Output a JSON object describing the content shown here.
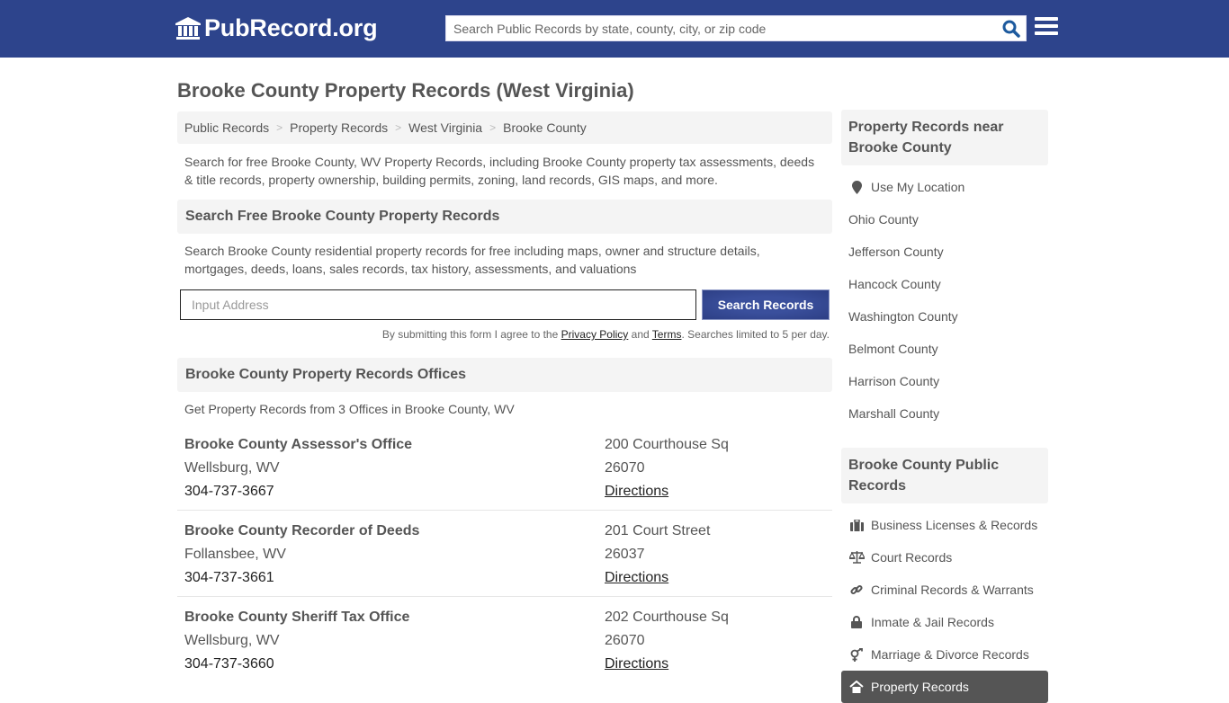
{
  "header": {
    "logo_text": "PubRecord.org",
    "search_placeholder": "Search Public Records by state, county, city, or zip code",
    "brand_color": "#2d448c"
  },
  "page_title": "Brooke County Property Records (West Virginia)",
  "breadcrumb": [
    "Public Records",
    "Property Records",
    "West Virginia",
    "Brooke County"
  ],
  "intro": "Search for free Brooke County, WV Property Records, including Brooke County property tax assessments, deeds & title records, property ownership, building permits, zoning, land records, GIS maps, and more.",
  "search_section": {
    "heading": "Search Free Brooke County Property Records",
    "description": "Search Brooke County residential property records for free including maps, owner and structure details, mortgages, deeds, loans, sales records, tax history, assessments, and valuations",
    "input_placeholder": "Input Address",
    "button_label": "Search Records",
    "disclaimer_prefix": "By submitting this form I agree to the ",
    "privacy_label": "Privacy Policy",
    "and_text": " and ",
    "terms_label": "Terms",
    "disclaimer_suffix": ". Searches limited to 5 per day."
  },
  "offices_section": {
    "heading": "Brooke County Property Records Offices",
    "subtitle": "Get Property Records from 3 Offices in Brooke County, WV",
    "offices": [
      {
        "name": "Brooke County Assessor's Office",
        "city": "Wellsburg, WV",
        "phone": "304-737-3667",
        "address": "200 Courthouse Sq",
        "zip": "26070",
        "directions_label": "Directions"
      },
      {
        "name": "Brooke County Recorder of Deeds",
        "city": "Follansbee, WV",
        "phone": "304-737-3661",
        "address": "201 Court Street",
        "zip": "26037",
        "directions_label": "Directions"
      },
      {
        "name": "Brooke County Sheriff Tax Office",
        "city": "Wellsburg, WV",
        "phone": "304-737-3660",
        "address": "202 Courthouse Sq",
        "zip": "26070",
        "directions_label": "Directions"
      }
    ]
  },
  "sidebar": {
    "nearby_heading": "Property Records near Brooke County",
    "use_location_label": "Use My Location",
    "nearby": [
      "Ohio County",
      "Jefferson County",
      "Hancock County",
      "Washington County",
      "Belmont County",
      "Harrison County",
      "Marshall County"
    ],
    "public_heading": "Brooke County Public Records",
    "public_items": [
      {
        "label": "Business Licenses & Records",
        "icon": "briefcase-icon"
      },
      {
        "label": "Court Records",
        "icon": "scales-icon"
      },
      {
        "label": "Criminal Records & Warrants",
        "icon": "link-icon"
      },
      {
        "label": "Inmate & Jail Records",
        "icon": "lock-icon"
      },
      {
        "label": "Marriage & Divorce Records",
        "icon": "gender-icon"
      },
      {
        "label": "Property Records",
        "icon": "home-icon",
        "active": true
      }
    ]
  }
}
